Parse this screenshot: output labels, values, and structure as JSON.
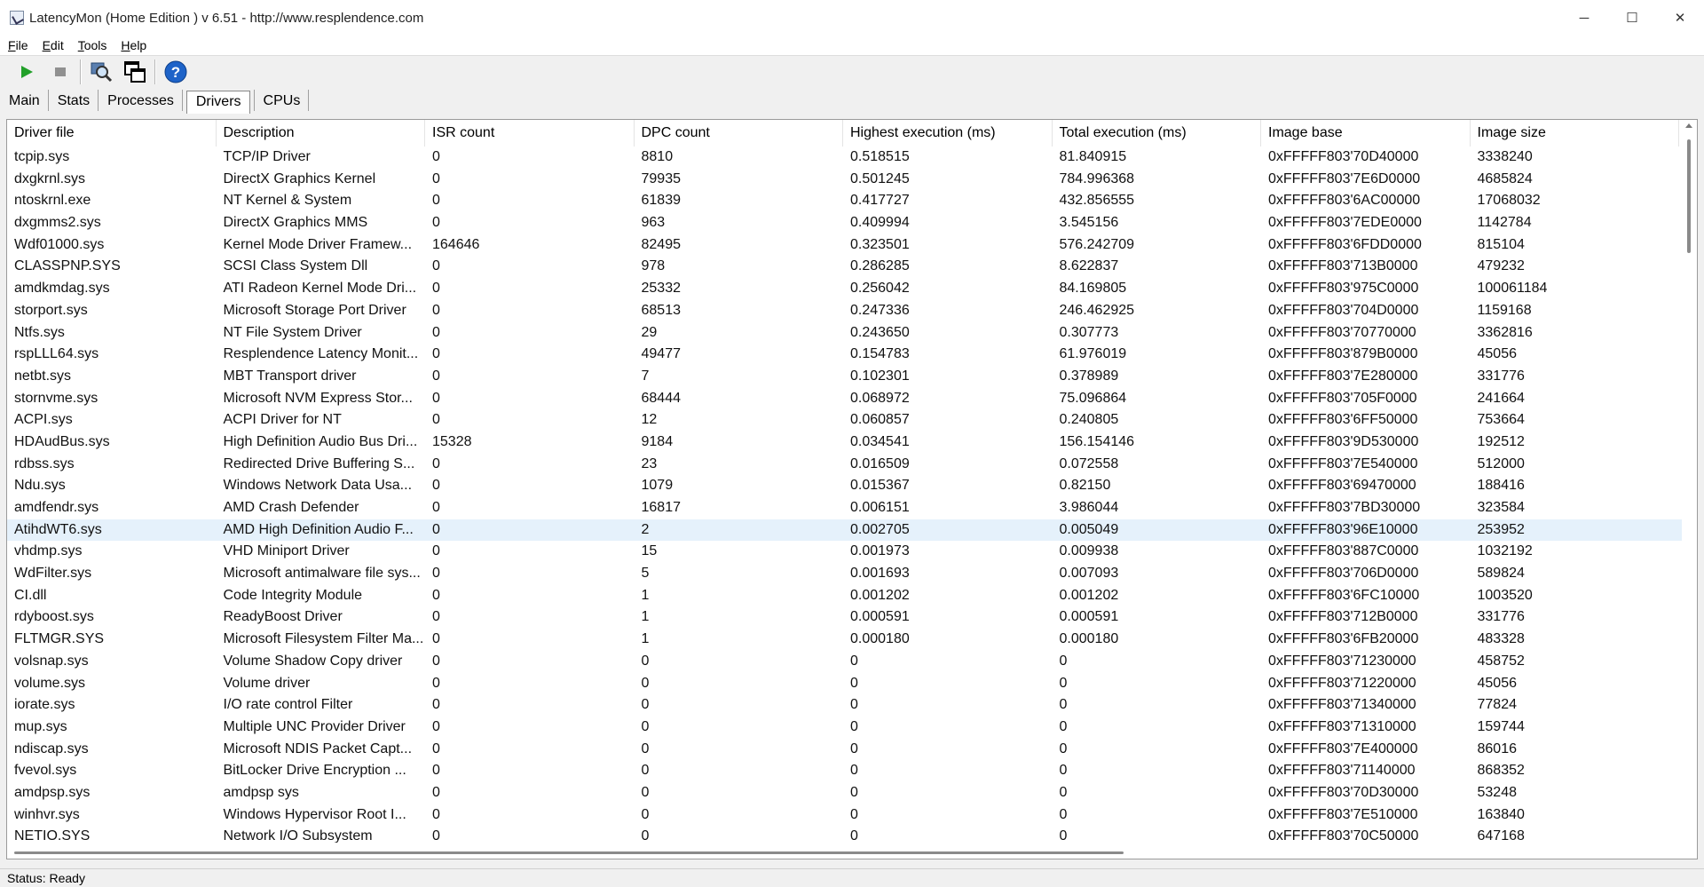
{
  "window": {
    "title": "LatencyMon  (Home Edition )  v 6.51 - http://www.resplendence.com",
    "minimize": "─",
    "maximize": "☐",
    "close": "✕"
  },
  "menu": [
    {
      "accel": "F",
      "rest": "ile"
    },
    {
      "accel": "E",
      "rest": "dit"
    },
    {
      "accel": "T",
      "rest": "ools"
    },
    {
      "accel": "H",
      "rest": "elp"
    }
  ],
  "toolbar": {
    "icons": [
      "play-icon",
      "stop-icon",
      "search-icon",
      "windows-icon",
      "help-icon"
    ],
    "colors": {
      "play": "#22a02a",
      "stop": "#909090",
      "help": "#1e63c8"
    }
  },
  "tabs": [
    "Main",
    "Stats",
    "Processes",
    "Drivers",
    "CPUs"
  ],
  "active_tab": "Drivers",
  "table": {
    "columns": [
      "Driver file",
      "Description",
      "ISR count",
      "DPC count",
      "Highest execution (ms)",
      "Total execution (ms)",
      "Image base",
      "Image size"
    ],
    "selected_row": 17,
    "rows": [
      [
        "tcpip.sys",
        "TCP/IP Driver",
        "0",
        "8810",
        "0.518515",
        "81.840915",
        "0xFFFFF803'70D40000",
        "3338240"
      ],
      [
        "dxgkrnl.sys",
        "DirectX Graphics Kernel",
        "0",
        "79935",
        "0.501245",
        "784.996368",
        "0xFFFFF803'7E6D0000",
        "4685824"
      ],
      [
        "ntoskrnl.exe",
        "NT Kernel & System",
        "0",
        "61839",
        "0.417727",
        "432.856555",
        "0xFFFFF803'6AC00000",
        "17068032"
      ],
      [
        "dxgmms2.sys",
        "DirectX Graphics MMS",
        "0",
        "963",
        "0.409994",
        "3.545156",
        "0xFFFFF803'7EDE0000",
        "1142784"
      ],
      [
        "Wdf01000.sys",
        "Kernel Mode Driver Framew...",
        "164646",
        "82495",
        "0.323501",
        "576.242709",
        "0xFFFFF803'6FDD0000",
        "815104"
      ],
      [
        "CLASSPNP.SYS",
        "SCSI Class System Dll",
        "0",
        "978",
        "0.286285",
        "8.622837",
        "0xFFFFF803'713B0000",
        "479232"
      ],
      [
        "amdkmdag.sys",
        "ATI Radeon Kernel Mode Dri...",
        "0",
        "25332",
        "0.256042",
        "84.169805",
        "0xFFFFF803'975C0000",
        "100061184"
      ],
      [
        "storport.sys",
        "Microsoft Storage Port Driver",
        "0",
        "68513",
        "0.247336",
        "246.462925",
        "0xFFFFF803'704D0000",
        "1159168"
      ],
      [
        "Ntfs.sys",
        "NT File System Driver",
        "0",
        "29",
        "0.243650",
        "0.307773",
        "0xFFFFF803'70770000",
        "3362816"
      ],
      [
        "rspLLL64.sys",
        "Resplendence Latency Monit...",
        "0",
        "49477",
        "0.154783",
        "61.976019",
        "0xFFFFF803'879B0000",
        "45056"
      ],
      [
        "netbt.sys",
        "MBT Transport driver",
        "0",
        "7",
        "0.102301",
        "0.378989",
        "0xFFFFF803'7E280000",
        "331776"
      ],
      [
        "stornvme.sys",
        "Microsoft NVM Express Stor...",
        "0",
        "68444",
        "0.068972",
        "75.096864",
        "0xFFFFF803'705F0000",
        "241664"
      ],
      [
        "ACPI.sys",
        "ACPI Driver for NT",
        "0",
        "12",
        "0.060857",
        "0.240805",
        "0xFFFFF803'6FF50000",
        "753664"
      ],
      [
        "HDAudBus.sys",
        "High Definition Audio Bus Dri...",
        "15328",
        "9184",
        "0.034541",
        "156.154146",
        "0xFFFFF803'9D530000",
        "192512"
      ],
      [
        "rdbss.sys",
        "Redirected Drive Buffering S...",
        "0",
        "23",
        "0.016509",
        "0.072558",
        "0xFFFFF803'7E540000",
        "512000"
      ],
      [
        "Ndu.sys",
        "Windows Network Data Usa...",
        "0",
        "1079",
        "0.015367",
        "0.82150",
        "0xFFFFF803'69470000",
        "188416"
      ],
      [
        "amdfendr.sys",
        "AMD Crash Defender",
        "0",
        "16817",
        "0.006151",
        "3.986044",
        "0xFFFFF803'7BD30000",
        "323584"
      ],
      [
        "AtihdWT6.sys",
        "AMD High Definition Audio F...",
        "0",
        "2",
        "0.002705",
        "0.005049",
        "0xFFFFF803'96E10000",
        "253952"
      ],
      [
        "vhdmp.sys",
        "VHD Miniport Driver",
        "0",
        "15",
        "0.001973",
        "0.009938",
        "0xFFFFF803'887C0000",
        "1032192"
      ],
      [
        "WdFilter.sys",
        "Microsoft antimalware file sys...",
        "0",
        "5",
        "0.001693",
        "0.007093",
        "0xFFFFF803'706D0000",
        "589824"
      ],
      [
        "CI.dll",
        "Code Integrity Module",
        "0",
        "1",
        "0.001202",
        "0.001202",
        "0xFFFFF803'6FC10000",
        "1003520"
      ],
      [
        "rdyboost.sys",
        "ReadyBoost Driver",
        "0",
        "1",
        "0.000591",
        "0.000591",
        "0xFFFFF803'712B0000",
        "331776"
      ],
      [
        "FLTMGR.SYS",
        "Microsoft Filesystem Filter Ma...",
        "0",
        "1",
        "0.000180",
        "0.000180",
        "0xFFFFF803'6FB20000",
        "483328"
      ],
      [
        "volsnap.sys",
        "Volume Shadow Copy driver",
        "0",
        "0",
        "0",
        "0",
        "0xFFFFF803'71230000",
        "458752"
      ],
      [
        "volume.sys",
        "Volume driver",
        "0",
        "0",
        "0",
        "0",
        "0xFFFFF803'71220000",
        "45056"
      ],
      [
        "iorate.sys",
        "I/O rate control Filter",
        "0",
        "0",
        "0",
        "0",
        "0xFFFFF803'71340000",
        "77824"
      ],
      [
        "mup.sys",
        "Multiple UNC Provider Driver",
        "0",
        "0",
        "0",
        "0",
        "0xFFFFF803'71310000",
        "159744"
      ],
      [
        "ndiscap.sys",
        "Microsoft NDIS Packet Capt...",
        "0",
        "0",
        "0",
        "0",
        "0xFFFFF803'7E400000",
        "86016"
      ],
      [
        "fvevol.sys",
        "BitLocker Drive Encryption ...",
        "0",
        "0",
        "0",
        "0",
        "0xFFFFF803'71140000",
        "868352"
      ],
      [
        "amdpsp.sys",
        "amdpsp sys",
        "0",
        "0",
        "0",
        "0",
        "0xFFFFF803'70D30000",
        "53248"
      ],
      [
        "winhvr.sys",
        "Windows Hypervisor Root I...",
        "0",
        "0",
        "0",
        "0",
        "0xFFFFF803'7E510000",
        "163840"
      ],
      [
        "NETIO.SYS",
        "Network I/O Subsystem",
        "0",
        "0",
        "0",
        "0",
        "0xFFFFF803'70C50000",
        "647168"
      ]
    ]
  },
  "status": "Status: Ready"
}
